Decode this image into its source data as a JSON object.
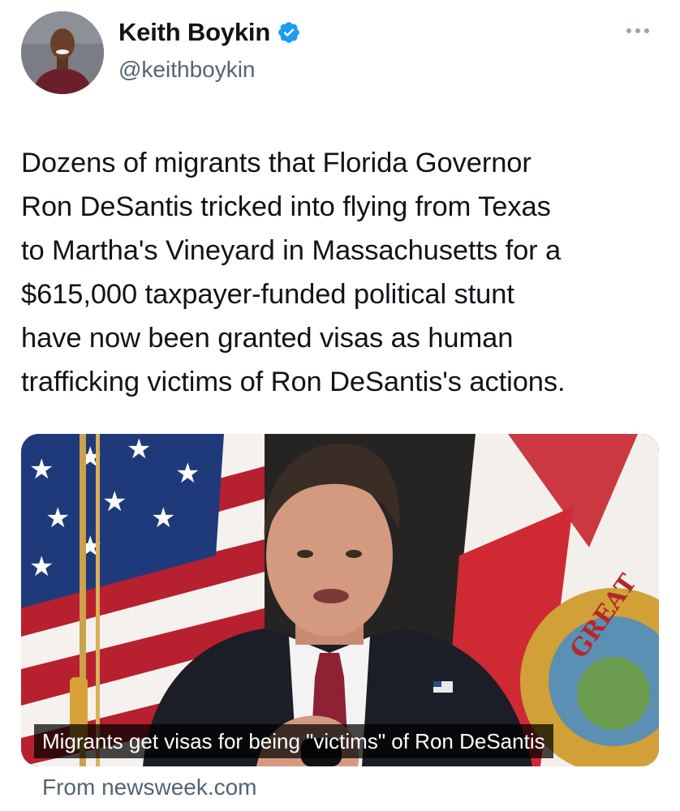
{
  "author": {
    "display_name": "Keith Boykin",
    "handle": "@keithboykin",
    "verified": true
  },
  "tweet": {
    "text_lines": [
      "Dozens of migrants that Florida Governor",
      "Ron DeSantis tricked into flying from Texas",
      "to Martha's Vineyard in Massachusetts for a",
      "$615,000 taxpayer-funded political stunt",
      "have now been granted visas as human",
      "trafficking victims of Ron DeSantis's actions."
    ]
  },
  "link_card": {
    "caption": "Migrants get visas for being \"victims\" of Ron DeSantis",
    "source": "From newsweek.com",
    "seal_text": "GREAT"
  },
  "icons": {
    "verified": "verified-badge-icon",
    "more": "more-options-icon"
  },
  "colors": {
    "verified_blue": "#1d9bf0",
    "secondary_text": "#536471",
    "primary_text": "#0f1419"
  }
}
